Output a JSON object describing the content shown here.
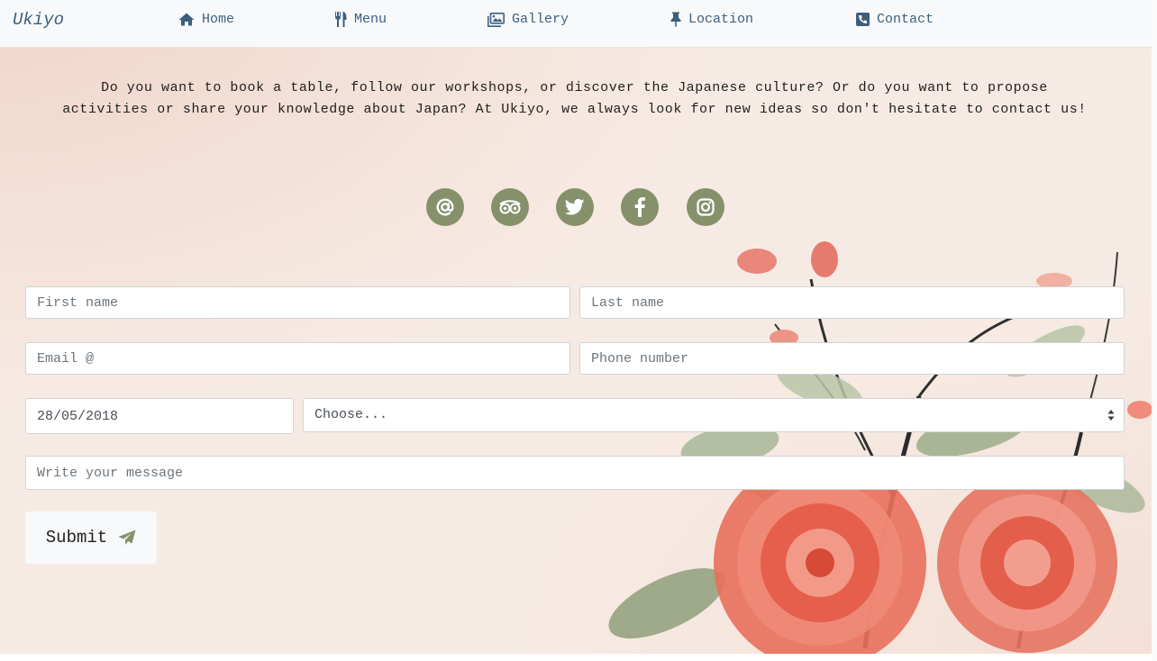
{
  "nav": {
    "brand": "Ukiyo",
    "items": [
      {
        "label": "Home",
        "icon": "home-icon"
      },
      {
        "label": "Menu",
        "icon": "utensils-icon"
      },
      {
        "label": "Gallery",
        "icon": "images-icon"
      },
      {
        "label": "Location",
        "icon": "thumbtack-icon"
      },
      {
        "label": "Contact",
        "icon": "phone-square-icon"
      }
    ],
    "color": "#3d5f7e"
  },
  "intro": {
    "text": "Do you want to book a table, follow our workshops, or discover the Japanese culture? Or do you want to propose activities or share your knowledge about Japan? At Ukiyo, we always look for new ideas so don't hesitate to contact us!"
  },
  "social": {
    "icons": [
      "at-icon",
      "tripadvisor-icon",
      "twitter-icon",
      "facebook-icon",
      "instagram-icon"
    ],
    "color": "#86906a"
  },
  "form": {
    "first_name_placeholder": "First name",
    "last_name_placeholder": "Last name",
    "email_placeholder": "Email @",
    "phone_placeholder": "Phone number",
    "date_value": "28/05/2018",
    "select_value": "Choose...",
    "message_placeholder": "Write your message",
    "submit_label": "Submit",
    "submit_icon": "paper-plane-icon"
  }
}
